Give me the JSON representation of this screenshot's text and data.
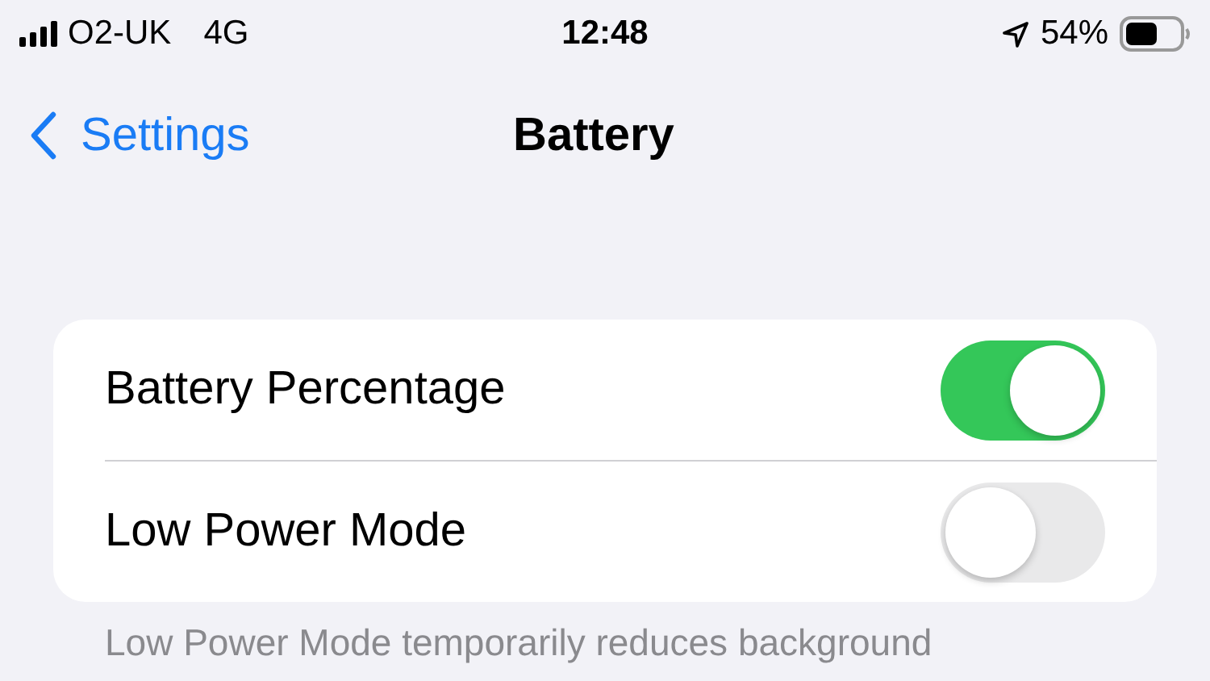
{
  "status_bar": {
    "carrier": "O2-UK",
    "network": "4G",
    "time": "12:48",
    "battery_percent": "54%"
  },
  "nav": {
    "back": "Settings",
    "title": "Battery"
  },
  "settings": [
    {
      "label": "Battery Percentage",
      "on": true
    },
    {
      "label": "Low Power Mode",
      "on": false
    }
  ],
  "footer": "Low Power Mode temporarily reduces background"
}
